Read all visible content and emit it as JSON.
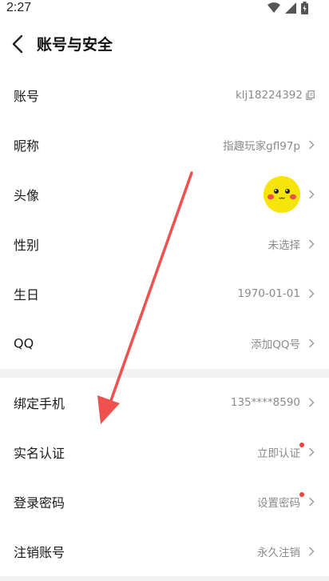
{
  "status_bar": {
    "time": "2:27"
  },
  "header": {
    "title": "账号与安全"
  },
  "section1": [
    {
      "label": "账号",
      "value": "klj18224392"
    },
    {
      "label": "昵称",
      "value": "指趣玩家gfl97p"
    },
    {
      "label": "头像",
      "value": ""
    },
    {
      "label": "性别",
      "value": "未选择"
    },
    {
      "label": "生日",
      "value": "1970-01-01"
    },
    {
      "label": "QQ",
      "value": "添加QQ号"
    }
  ],
  "section2": [
    {
      "label": "绑定手机",
      "value": "135****8590"
    },
    {
      "label": "实名认证",
      "value": "立即认证"
    },
    {
      "label": "登录密码",
      "value": "设置密码"
    },
    {
      "label": "注销账号",
      "value": "永久注销"
    }
  ],
  "colors": {
    "accent_red": "#f2403a",
    "annotation_arrow": "#f0504e",
    "avatar_yellow": "#f7e40b"
  },
  "icons": [
    "back-icon",
    "copy-icon",
    "chevron-right-icon",
    "wifi-icon",
    "signal-icon",
    "battery-icon"
  ]
}
